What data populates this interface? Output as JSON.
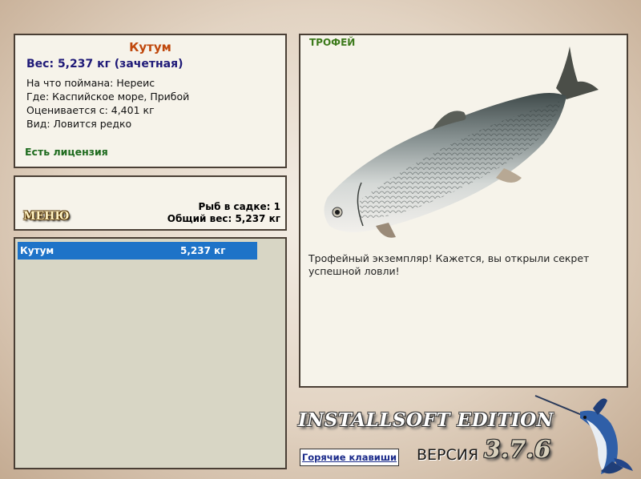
{
  "info": {
    "fish_name": "Кутум",
    "weight": "Вес: 5,237 кг (зачетная)",
    "bait": "На что поймана: Нереис",
    "location": "Где: Каспийское море, Прибой",
    "valued_from": "Оценивается с: 4,401 кг",
    "species_status": "Вид: Ловится редко",
    "license": "Есть лицензия"
  },
  "summary": {
    "menu_label": "МЕНЮ",
    "fish_count": "Рыб в садке: 1",
    "total_weight": "Общий вес: 5,237 кг"
  },
  "cage": {
    "rows": [
      {
        "name": "Кутум",
        "weight": "5,237 кг"
      }
    ],
    "selected_color": "#1e73c8"
  },
  "trophy": {
    "label": "ТРОФЕЙ",
    "message": "Трофейный экземпляр! Кажется, вы открыли секрет успешной ловли!"
  },
  "footer": {
    "hotkeys_label": "Горячие клавиши",
    "edition": "INSTALLSOFT EDITION",
    "version_label": "ВЕРСИЯ",
    "version_number": "3.7.6"
  },
  "icons": {
    "fish_image": "fish-kutum-icon",
    "logo": "marlin-logo-icon"
  }
}
